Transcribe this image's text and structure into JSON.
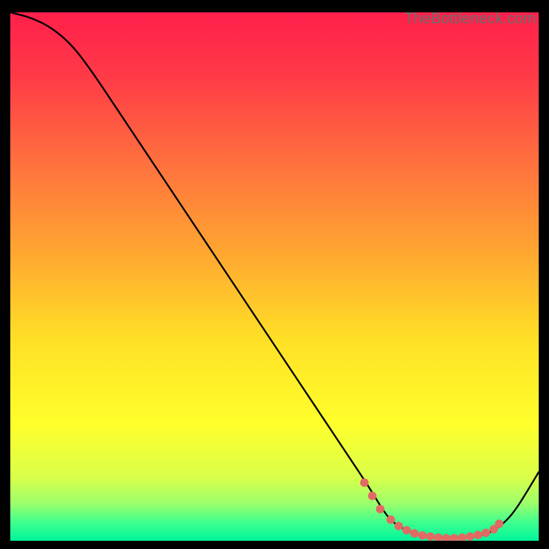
{
  "watermark": "TheBottleneck.com",
  "chart_data": {
    "type": "line",
    "title": "",
    "xlabel": "",
    "ylabel": "",
    "xlim": [
      0,
      100
    ],
    "ylim": [
      0,
      100
    ],
    "series": [
      {
        "name": "curve",
        "x": [
          0,
          4,
          8,
          12,
          16,
          20,
          24,
          28,
          32,
          36,
          40,
          44,
          48,
          52,
          56,
          60,
          64,
          68,
          71,
          73,
          76,
          79,
          82,
          85,
          88,
          91,
          93,
          95,
          97,
          100
        ],
        "values": [
          100,
          99,
          97,
          93.5,
          88,
          82,
          76,
          70,
          64,
          58,
          52,
          46,
          40,
          34,
          28,
          22,
          16,
          10,
          5,
          3,
          1.5,
          0.8,
          0.5,
          0.5,
          0.8,
          1.6,
          3,
          5,
          8,
          13
        ]
      }
    ],
    "markers": {
      "name": "highlight-dots",
      "x": [
        67,
        68.5,
        70,
        72,
        73.5,
        75,
        76.5,
        78,
        79.5,
        81,
        82.5,
        84,
        85.5,
        87,
        88.5,
        90,
        91.5,
        92.5
      ],
      "values": [
        11,
        8.5,
        6,
        4,
        2.8,
        2,
        1.4,
        1.0,
        0.8,
        0.6,
        0.5,
        0.5,
        0.6,
        0.8,
        1.1,
        1.5,
        2.2,
        3.2
      ]
    },
    "gradient_stops": [
      {
        "offset": 0.0,
        "color": "#ff1f4b"
      },
      {
        "offset": 0.12,
        "color": "#ff3a47"
      },
      {
        "offset": 0.28,
        "color": "#ff6f3e"
      },
      {
        "offset": 0.45,
        "color": "#ffa531"
      },
      {
        "offset": 0.62,
        "color": "#ffe026"
      },
      {
        "offset": 0.78,
        "color": "#ffff2b"
      },
      {
        "offset": 0.88,
        "color": "#d9ff4a"
      },
      {
        "offset": 0.93,
        "color": "#9bff6b"
      },
      {
        "offset": 0.965,
        "color": "#3fff8e"
      },
      {
        "offset": 1.0,
        "color": "#00f59b"
      }
    ]
  }
}
